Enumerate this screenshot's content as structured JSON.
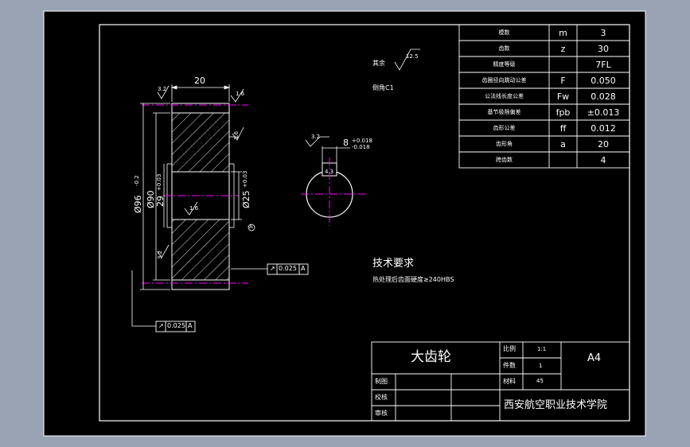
{
  "drawing": {
    "part_name": "大齿轮",
    "institution": "西安航空职业技术学院",
    "sheet_size": "A4",
    "title_block": {
      "scale_label": "比例",
      "scale_value": "1:1",
      "quantity_label": "件数",
      "quantity_value": "1",
      "material_label": "材料",
      "material_value": "45",
      "drawn_by_label": "制图",
      "checked_by_label": "校核",
      "reviewed_by_label": "审核"
    },
    "params_table": {
      "rows": [
        {
          "name": "模数",
          "symbol": "m",
          "value": "3"
        },
        {
          "name": "齿数",
          "symbol": "z",
          "value": "30"
        },
        {
          "name": "精度等级",
          "symbol": "",
          "value": "7FL"
        },
        {
          "name": "齿圈径向跳动公差",
          "symbol": "F",
          "value": "0.050"
        },
        {
          "name": "公法线长度公差",
          "symbol": "Fw",
          "value": "0.028"
        },
        {
          "name": "基节极限偏差",
          "symbol": "fpb",
          "value": "±0.013"
        },
        {
          "name": "齿形公差",
          "symbol": "ff",
          "value": "0.012"
        },
        {
          "name": "齿形角",
          "symbol": "a",
          "value": "20"
        },
        {
          "name": "跨齿数",
          "symbol": "",
          "value": "4"
        }
      ]
    },
    "notes": {
      "rest_label": "其余",
      "rest_roughness": "12.5",
      "chamfer": "倒角C1",
      "tech_title": "技术要求",
      "tech_line": "热处理后齿面硬度≥240HBS"
    },
    "dimensions": {
      "width": "20",
      "roughness_left_top": "3.2",
      "roughness_right_top": "1.6",
      "roughness_right_face": "1.6",
      "roughness_left_side": "3.2",
      "roughness_bore": "1.6",
      "tip_diameter": "Ø96",
      "tip_tol": "-0.2",
      "outer_diameter": "Ø90",
      "pitch_diameter": "29",
      "pitch_tol": "+0.03",
      "bore_diameter": "Ø25",
      "bore_tol": "+0.03",
      "keyway_width": "8",
      "keyway_tol": "+0.018 -0.018",
      "keyway_roughness": "3.2",
      "keyway_depth": "4.3",
      "fcf_value": "0.025",
      "fcf_datum": "A",
      "datum_label": "A"
    },
    "colors": {
      "background": "#000000",
      "lines": "#ffffff",
      "centerlines": "#ff00ff",
      "outer_frame": "#9aa3b3"
    }
  }
}
